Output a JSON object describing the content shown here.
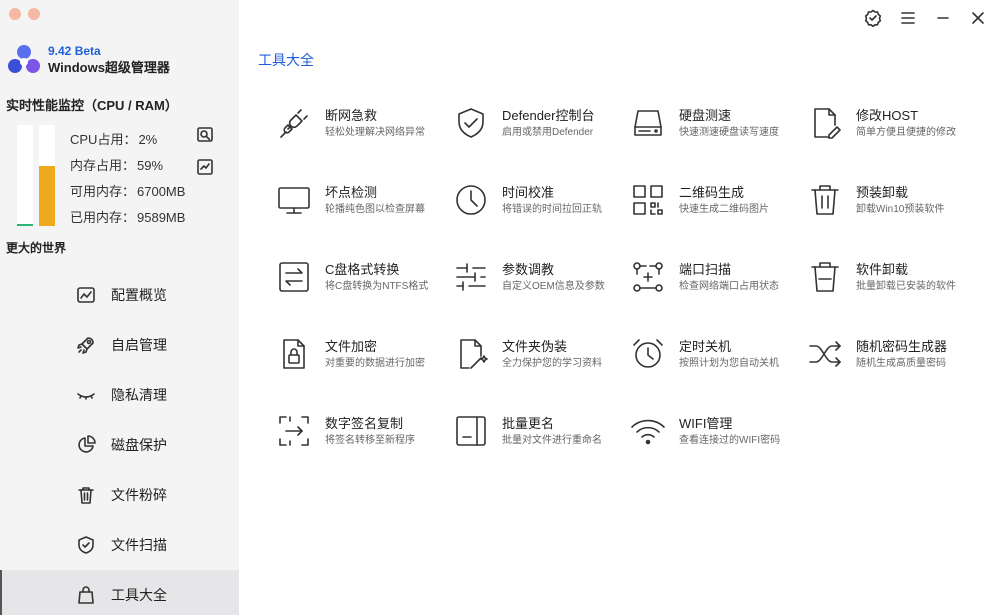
{
  "app": {
    "version": "9.42 Beta",
    "name": "Windows超级管理器"
  },
  "monitor": {
    "title": "实时性能监控（CPU / RAM）",
    "cpu_label": "CPU占用：",
    "cpu_value": "2%",
    "cpu_fraction": 0.02,
    "mem_label": "内存占用：",
    "mem_value": "59%",
    "mem_fraction": 0.59,
    "avail_label": "可用内存：",
    "avail_value": "6700MB",
    "used_label": "已用内存：",
    "used_value": "9589MB",
    "cpu_color": "#2bb673",
    "mem_color": "#f0a81c"
  },
  "slogan": "更大的世界",
  "nav": {
    "items": [
      {
        "label": "配置概览",
        "icon": "chart-icon"
      },
      {
        "label": "自启管理",
        "icon": "rocket-icon"
      },
      {
        "label": "隐私清理",
        "icon": "eye-closed-icon"
      },
      {
        "label": "磁盘保护",
        "icon": "pie-chart-icon"
      },
      {
        "label": "文件粉碎",
        "icon": "trash-icon"
      },
      {
        "label": "文件扫描",
        "icon": "shield-check-icon"
      },
      {
        "label": "工具大全",
        "icon": "bag-icon",
        "active": true
      }
    ]
  },
  "page": {
    "title": "工具大全"
  },
  "tools": [
    {
      "name": "断网急救",
      "desc": "轻松处理解决网络异常",
      "icon": "plug-icon"
    },
    {
      "name": "Defender控制台",
      "desc": "启用或禁用Defender",
      "icon": "shield-check-icon"
    },
    {
      "name": "硬盘测速",
      "desc": "快速测速硬盘读写速度",
      "icon": "hard-drive-icon"
    },
    {
      "name": "修改HOST",
      "desc": "简单方便且便捷的修改",
      "icon": "file-edit-icon"
    },
    {
      "name": "坏点检测",
      "desc": "轮播纯色图以检查屏幕",
      "icon": "monitor-icon"
    },
    {
      "name": "时间校准",
      "desc": "将错误的时间拉回正轨",
      "icon": "clock-icon"
    },
    {
      "name": "二维码生成",
      "desc": "快速生成二维码图片",
      "icon": "qr-code-icon"
    },
    {
      "name": "预装卸载",
      "desc": "卸载Win10预装软件",
      "icon": "trash-icon"
    },
    {
      "name": "C盘格式转换",
      "desc": "将C盘转换为NTFS格式",
      "icon": "swap-icon"
    },
    {
      "name": "参数调教",
      "desc": "自定义OEM信息及参数",
      "icon": "sliders-icon"
    },
    {
      "name": "端口扫描",
      "desc": "检查网络端口占用状态",
      "icon": "network-scan-icon"
    },
    {
      "name": "软件卸载",
      "desc": "批量卸载已安装的软件",
      "icon": "trash-icon"
    },
    {
      "name": "文件加密",
      "desc": "对重要的数据进行加密",
      "icon": "file-lock-icon"
    },
    {
      "name": "文件夹伪装",
      "desc": "全力保护您的学习资料",
      "icon": "file-magic-icon"
    },
    {
      "name": "定时关机",
      "desc": "按照计划为您自动关机",
      "icon": "alarm-clock-icon"
    },
    {
      "name": "随机密码生成器",
      "desc": "随机生成高质量密码",
      "icon": "shuffle-icon"
    },
    {
      "name": "数字签名复制",
      "desc": "将签名转移至新程序",
      "icon": "signature-copy-icon"
    },
    {
      "name": "批量更名",
      "desc": "批量对文件进行重命名",
      "icon": "rename-icon"
    },
    {
      "name": "WIFI管理",
      "desc": "查看连接过的WIFI密码",
      "icon": "wifi-icon"
    }
  ],
  "topbar": {
    "icons": [
      "verified-icon",
      "menu-icon",
      "minimize-icon",
      "close-icon"
    ]
  }
}
